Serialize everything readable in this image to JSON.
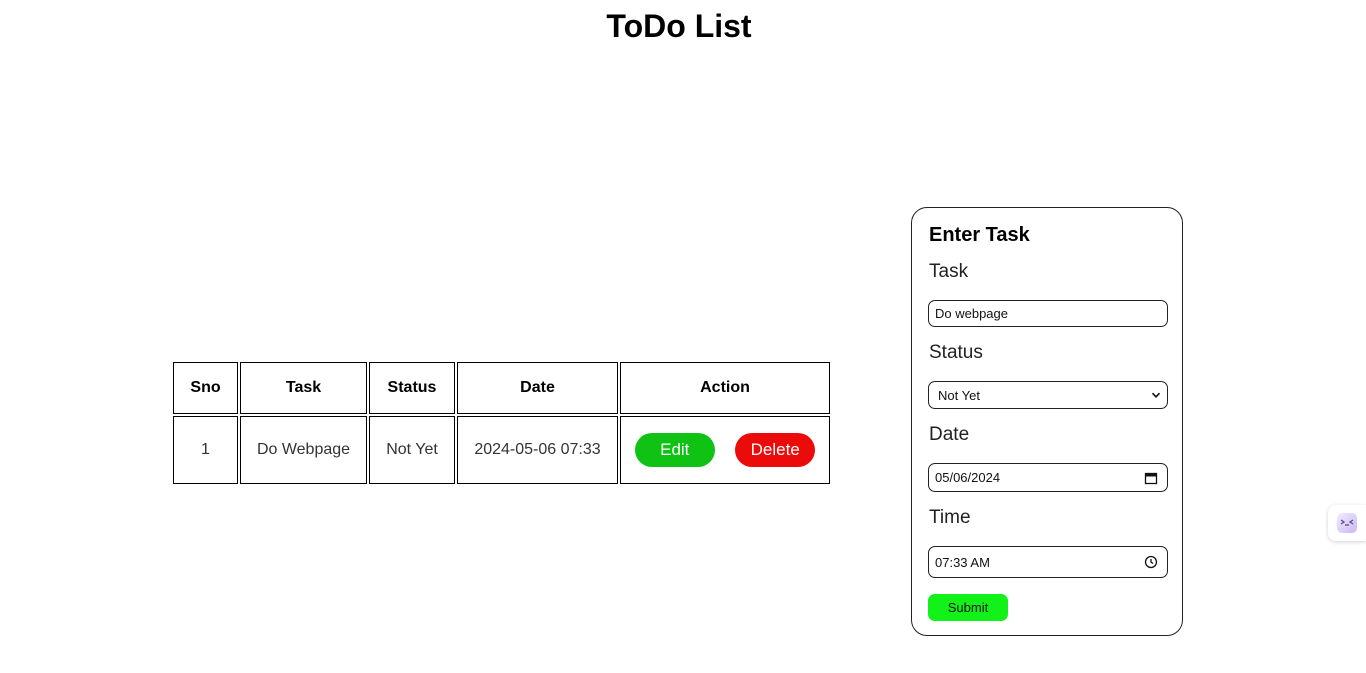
{
  "page": {
    "title": "ToDo List"
  },
  "table": {
    "headers": [
      "Sno",
      "Task",
      "Status",
      "Date",
      "Action"
    ],
    "rows": [
      {
        "sno": "1",
        "task": "Do Webpage",
        "status": "Not Yet",
        "date": "2024-05-06 07:33",
        "edit_label": "Edit",
        "delete_label": "Delete"
      }
    ]
  },
  "form": {
    "heading": "Enter Task",
    "task_label": "Task",
    "task_value": "Do webpage",
    "status_label": "Status",
    "status_value": "Not Yet",
    "date_label": "Date",
    "date_value": "05/06/2024",
    "time_label": "Time",
    "time_value": "07:33 AM",
    "submit_label": "Submit"
  },
  "colors": {
    "edit_button": "#0fc214",
    "delete_button": "#ec0b0b",
    "submit_button": "#12f218"
  },
  "icons": [
    "chevron-down-icon",
    "calendar-icon",
    "clock-icon",
    "assistant-widget-icon"
  ]
}
